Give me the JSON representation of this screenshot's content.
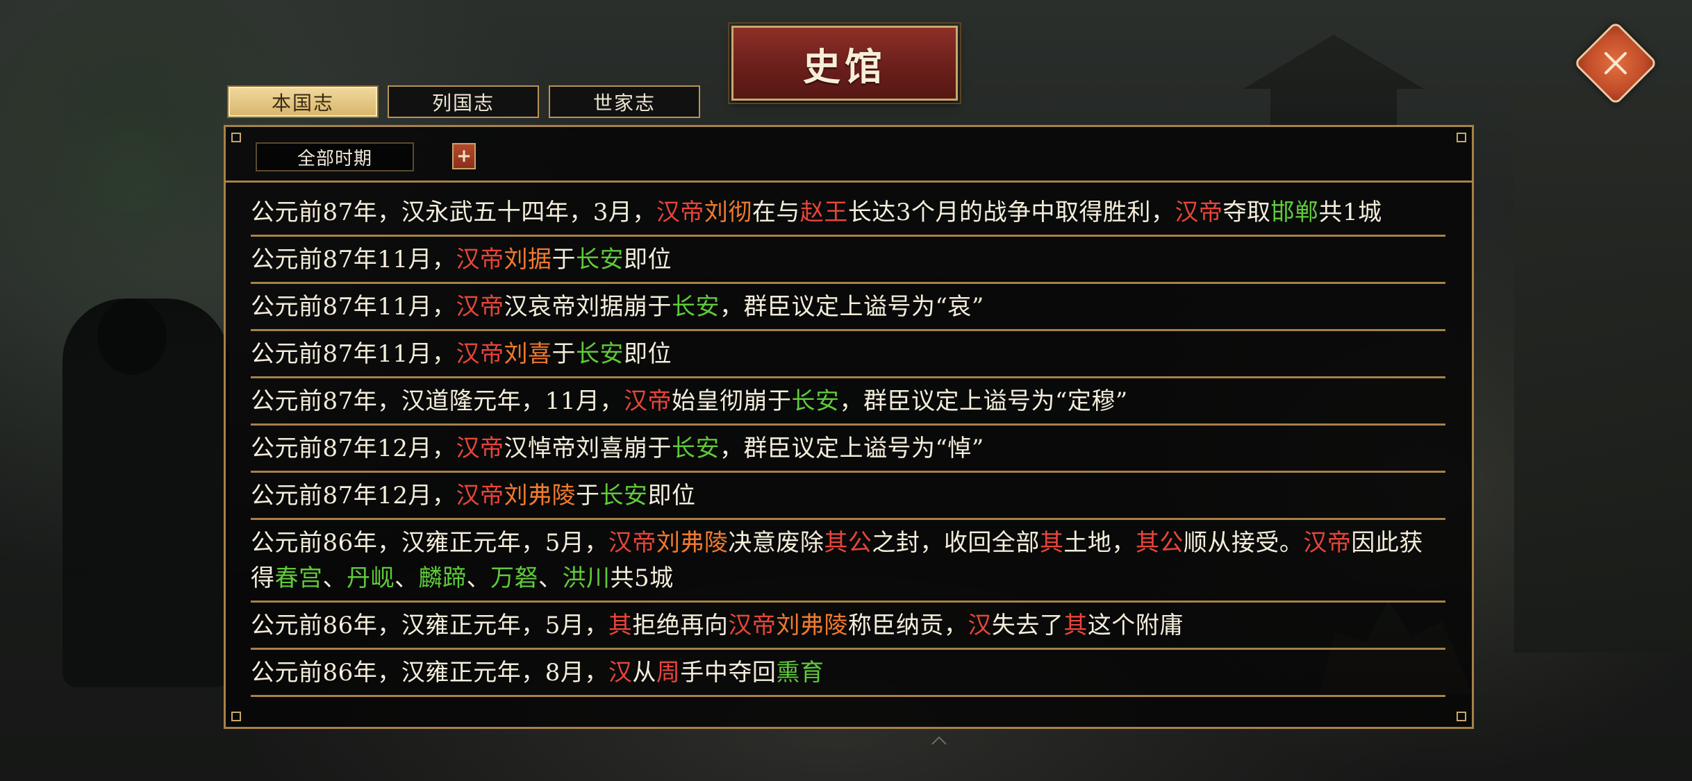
{
  "title": "史馆",
  "tabs": [
    {
      "label": "本国志",
      "active": true
    },
    {
      "label": "列国志",
      "active": false
    },
    {
      "label": "世家志",
      "active": false
    }
  ],
  "filter": {
    "period": "全部时期",
    "expand_symbol": "+"
  },
  "colors": {
    "white": "#f4eddb",
    "red": "#e8453a",
    "orange": "#f07a2e",
    "green": "#5fca3a",
    "gold_border": "#a68248",
    "plaque": "#7a2520"
  },
  "icons": {
    "close": "close-icon",
    "expand": "plus-icon"
  },
  "records": [
    {
      "segments": [
        {
          "t": "公元前87年，汉永武五十四年，3月，",
          "c": "w"
        },
        {
          "t": "汉帝",
          "c": "r"
        },
        {
          "t": "刘彻",
          "c": "o"
        },
        {
          "t": "在与",
          "c": "w"
        },
        {
          "t": "赵王",
          "c": "r"
        },
        {
          "t": "长达3个月的战争中取得胜利，",
          "c": "w"
        },
        {
          "t": "汉帝",
          "c": "r"
        },
        {
          "t": "夺取",
          "c": "w"
        },
        {
          "t": "邯郸",
          "c": "g"
        },
        {
          "t": "共1城",
          "c": "w"
        }
      ]
    },
    {
      "segments": [
        {
          "t": "公元前87年11月，",
          "c": "w"
        },
        {
          "t": "汉帝",
          "c": "r"
        },
        {
          "t": "刘据",
          "c": "o"
        },
        {
          "t": "于",
          "c": "w"
        },
        {
          "t": "长安",
          "c": "g"
        },
        {
          "t": "即位",
          "c": "w"
        }
      ]
    },
    {
      "segments": [
        {
          "t": "公元前87年11月，",
          "c": "w"
        },
        {
          "t": "汉帝",
          "c": "r"
        },
        {
          "t": "汉哀帝刘据崩于",
          "c": "w"
        },
        {
          "t": "长安",
          "c": "g"
        },
        {
          "t": "，群臣议定上谥号为“哀”",
          "c": "w"
        }
      ]
    },
    {
      "segments": [
        {
          "t": "公元前87年11月，",
          "c": "w"
        },
        {
          "t": "汉帝",
          "c": "r"
        },
        {
          "t": "刘喜",
          "c": "o"
        },
        {
          "t": "于",
          "c": "w"
        },
        {
          "t": "长安",
          "c": "g"
        },
        {
          "t": "即位",
          "c": "w"
        }
      ]
    },
    {
      "segments": [
        {
          "t": "公元前87年，汉道隆元年，11月，",
          "c": "w"
        },
        {
          "t": "汉帝",
          "c": "r"
        },
        {
          "t": "始皇彻崩于",
          "c": "w"
        },
        {
          "t": "长安",
          "c": "g"
        },
        {
          "t": "，群臣议定上谥号为“定穆”",
          "c": "w"
        }
      ]
    },
    {
      "segments": [
        {
          "t": "公元前87年12月，",
          "c": "w"
        },
        {
          "t": "汉帝",
          "c": "r"
        },
        {
          "t": "汉悼帝刘喜崩于",
          "c": "w"
        },
        {
          "t": "长安",
          "c": "g"
        },
        {
          "t": "，群臣议定上谥号为“悼”",
          "c": "w"
        }
      ]
    },
    {
      "segments": [
        {
          "t": "公元前87年12月，",
          "c": "w"
        },
        {
          "t": "汉帝",
          "c": "r"
        },
        {
          "t": "刘弗陵",
          "c": "o"
        },
        {
          "t": "于",
          "c": "w"
        },
        {
          "t": "长安",
          "c": "g"
        },
        {
          "t": "即位",
          "c": "w"
        }
      ]
    },
    {
      "segments": [
        {
          "t": "公元前86年，汉雍正元年，5月，",
          "c": "w"
        },
        {
          "t": "汉帝",
          "c": "r"
        },
        {
          "t": "刘弗陵",
          "c": "o"
        },
        {
          "t": "决意废除",
          "c": "w"
        },
        {
          "t": "其公",
          "c": "r"
        },
        {
          "t": "之封，收回全部",
          "c": "w"
        },
        {
          "t": "其",
          "c": "r"
        },
        {
          "t": "土地，",
          "c": "w"
        },
        {
          "t": "其公",
          "c": "r"
        },
        {
          "t": "顺从接受。",
          "c": "w"
        },
        {
          "t": "汉帝",
          "c": "r"
        },
        {
          "t": "因此获得",
          "c": "w"
        },
        {
          "t": "春宫",
          "c": "g"
        },
        {
          "t": "、",
          "c": "w"
        },
        {
          "t": "丹岘",
          "c": "g"
        },
        {
          "t": "、",
          "c": "w"
        },
        {
          "t": "麟蹄",
          "c": "g"
        },
        {
          "t": "、",
          "c": "w"
        },
        {
          "t": "万砮",
          "c": "g"
        },
        {
          "t": "、",
          "c": "w"
        },
        {
          "t": "洪川",
          "c": "g"
        },
        {
          "t": "共5城",
          "c": "w"
        }
      ]
    },
    {
      "segments": [
        {
          "t": "公元前86年，汉雍正元年，5月，",
          "c": "w"
        },
        {
          "t": "其",
          "c": "r"
        },
        {
          "t": "拒绝再向",
          "c": "w"
        },
        {
          "t": "汉帝",
          "c": "r"
        },
        {
          "t": "刘弗陵",
          "c": "o"
        },
        {
          "t": "称臣纳贡，",
          "c": "w"
        },
        {
          "t": "汉",
          "c": "r"
        },
        {
          "t": "失去了",
          "c": "w"
        },
        {
          "t": "其",
          "c": "r"
        },
        {
          "t": "这个附庸",
          "c": "w"
        }
      ]
    },
    {
      "segments": [
        {
          "t": "公元前86年，汉雍正元年，8月，",
          "c": "w"
        },
        {
          "t": "汉",
          "c": "r"
        },
        {
          "t": "从",
          "c": "w"
        },
        {
          "t": "周",
          "c": "r"
        },
        {
          "t": "手中夺回",
          "c": "w"
        },
        {
          "t": "熏育",
          "c": "g"
        }
      ]
    }
  ]
}
